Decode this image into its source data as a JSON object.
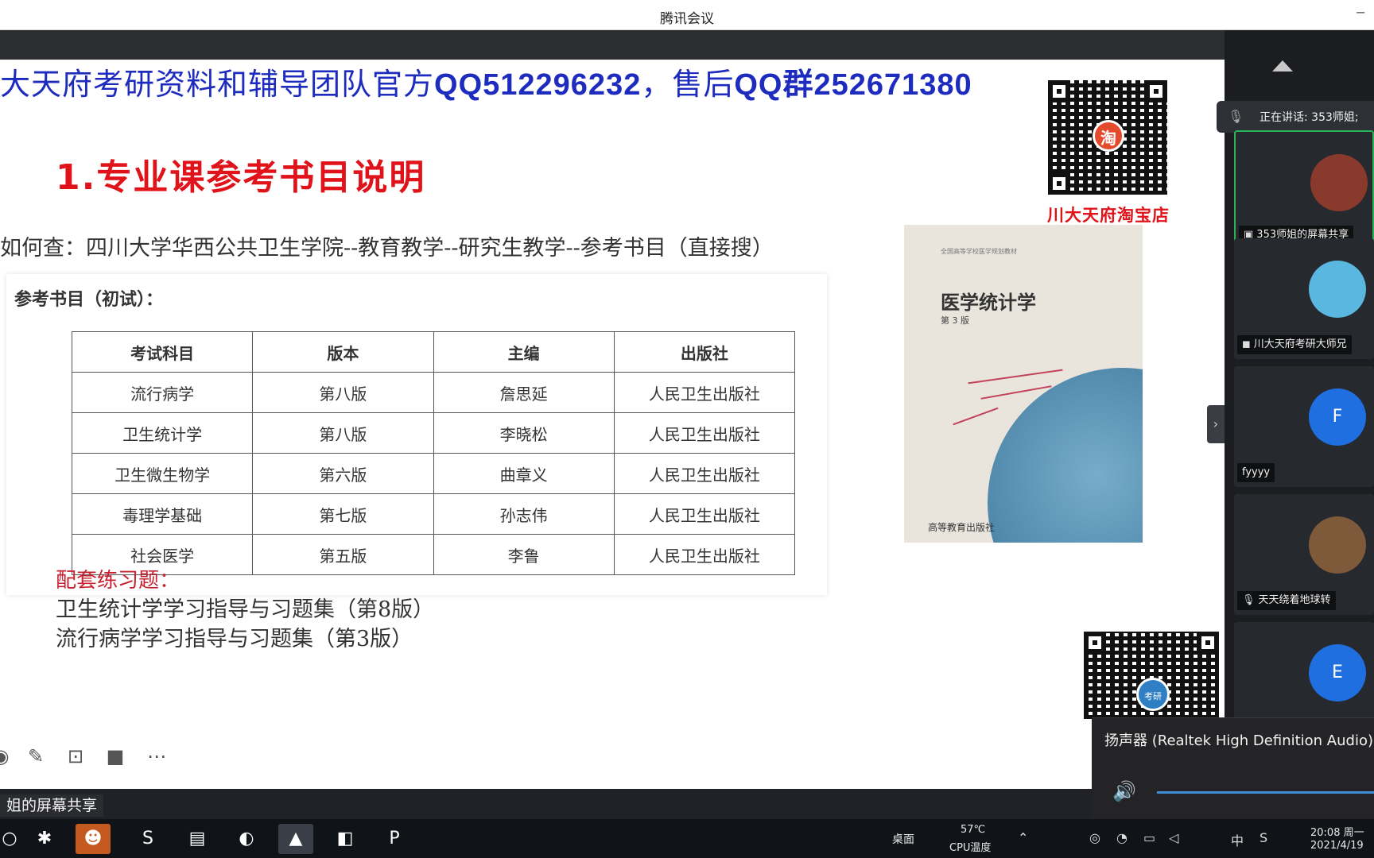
{
  "window": {
    "title": "腾讯会议"
  },
  "slide": {
    "banner_prefix": "大天府考研资料和辅导团队官方",
    "banner_qq": "QQ512296232",
    "banner_mid": "，售后",
    "banner_group": "QQ群252671380",
    "section_title": "1.专业课参考书目说明",
    "howto": "如何查：四川大学华西公共卫生学院--教育教学--研究生教学--参考书目（直接搜）",
    "table_caption": "参考书目（初试）：",
    "table": {
      "headers": [
        "考试科目",
        "版本",
        "主编",
        "出版社"
      ],
      "rows": [
        [
          "流行病学",
          "第八版",
          "詹思延",
          "人民卫生出版社"
        ],
        [
          "卫生统计学",
          "第八版",
          "李晓松",
          "人民卫生出版社"
        ],
        [
          "卫生微生物学",
          "第六版",
          "曲章义",
          "人民卫生出版社"
        ],
        [
          "毒理学基础",
          "第七版",
          "孙志伟",
          "人民卫生出版社"
        ],
        [
          "社会医学",
          "第五版",
          "李鲁",
          "人民卫生出版社"
        ]
      ]
    },
    "book": {
      "title": "医学统计学",
      "edition": "第 3 版",
      "series": "全国高等学校医学规划教材",
      "publisher": "高等教育出版社"
    },
    "taobao_logo": "淘",
    "taobao_label": "川大天府淘宝店",
    "bottom_qr_logo": "考研",
    "practice_heading": "配套练习题：",
    "practice_items": [
      "卫生统计学学习指导与习题集（第8版）",
      "流行病学学习指导与习题集（第3版）"
    ]
  },
  "sharer_label": "姐的屏幕共享",
  "panel": {
    "speaking": "正在讲话: 353师姐;",
    "participants": [
      {
        "name": "353师姐的屏幕共享",
        "avatar": "",
        "color": "#8a3a2c"
      },
      {
        "name": "川大天府考研大师兄",
        "avatar": "",
        "color": "#5ab8e0"
      },
      {
        "name": "fyyyy",
        "avatar": "F",
        "color": "#1f6fe0"
      },
      {
        "name": "天天绕着地球转",
        "avatar": "",
        "color": "#7f5a3a"
      },
      {
        "name": "",
        "avatar": "E",
        "color": "#1f6fe0"
      }
    ]
  },
  "audio": {
    "device": "扬声器 (Realtek High Definition Audio)"
  },
  "taskbar": {
    "desktop": "桌面",
    "temp": "57℃",
    "temp_label": "CPU温度",
    "ime": "中",
    "time": "20:08 周一",
    "date": "2021/4/19"
  }
}
